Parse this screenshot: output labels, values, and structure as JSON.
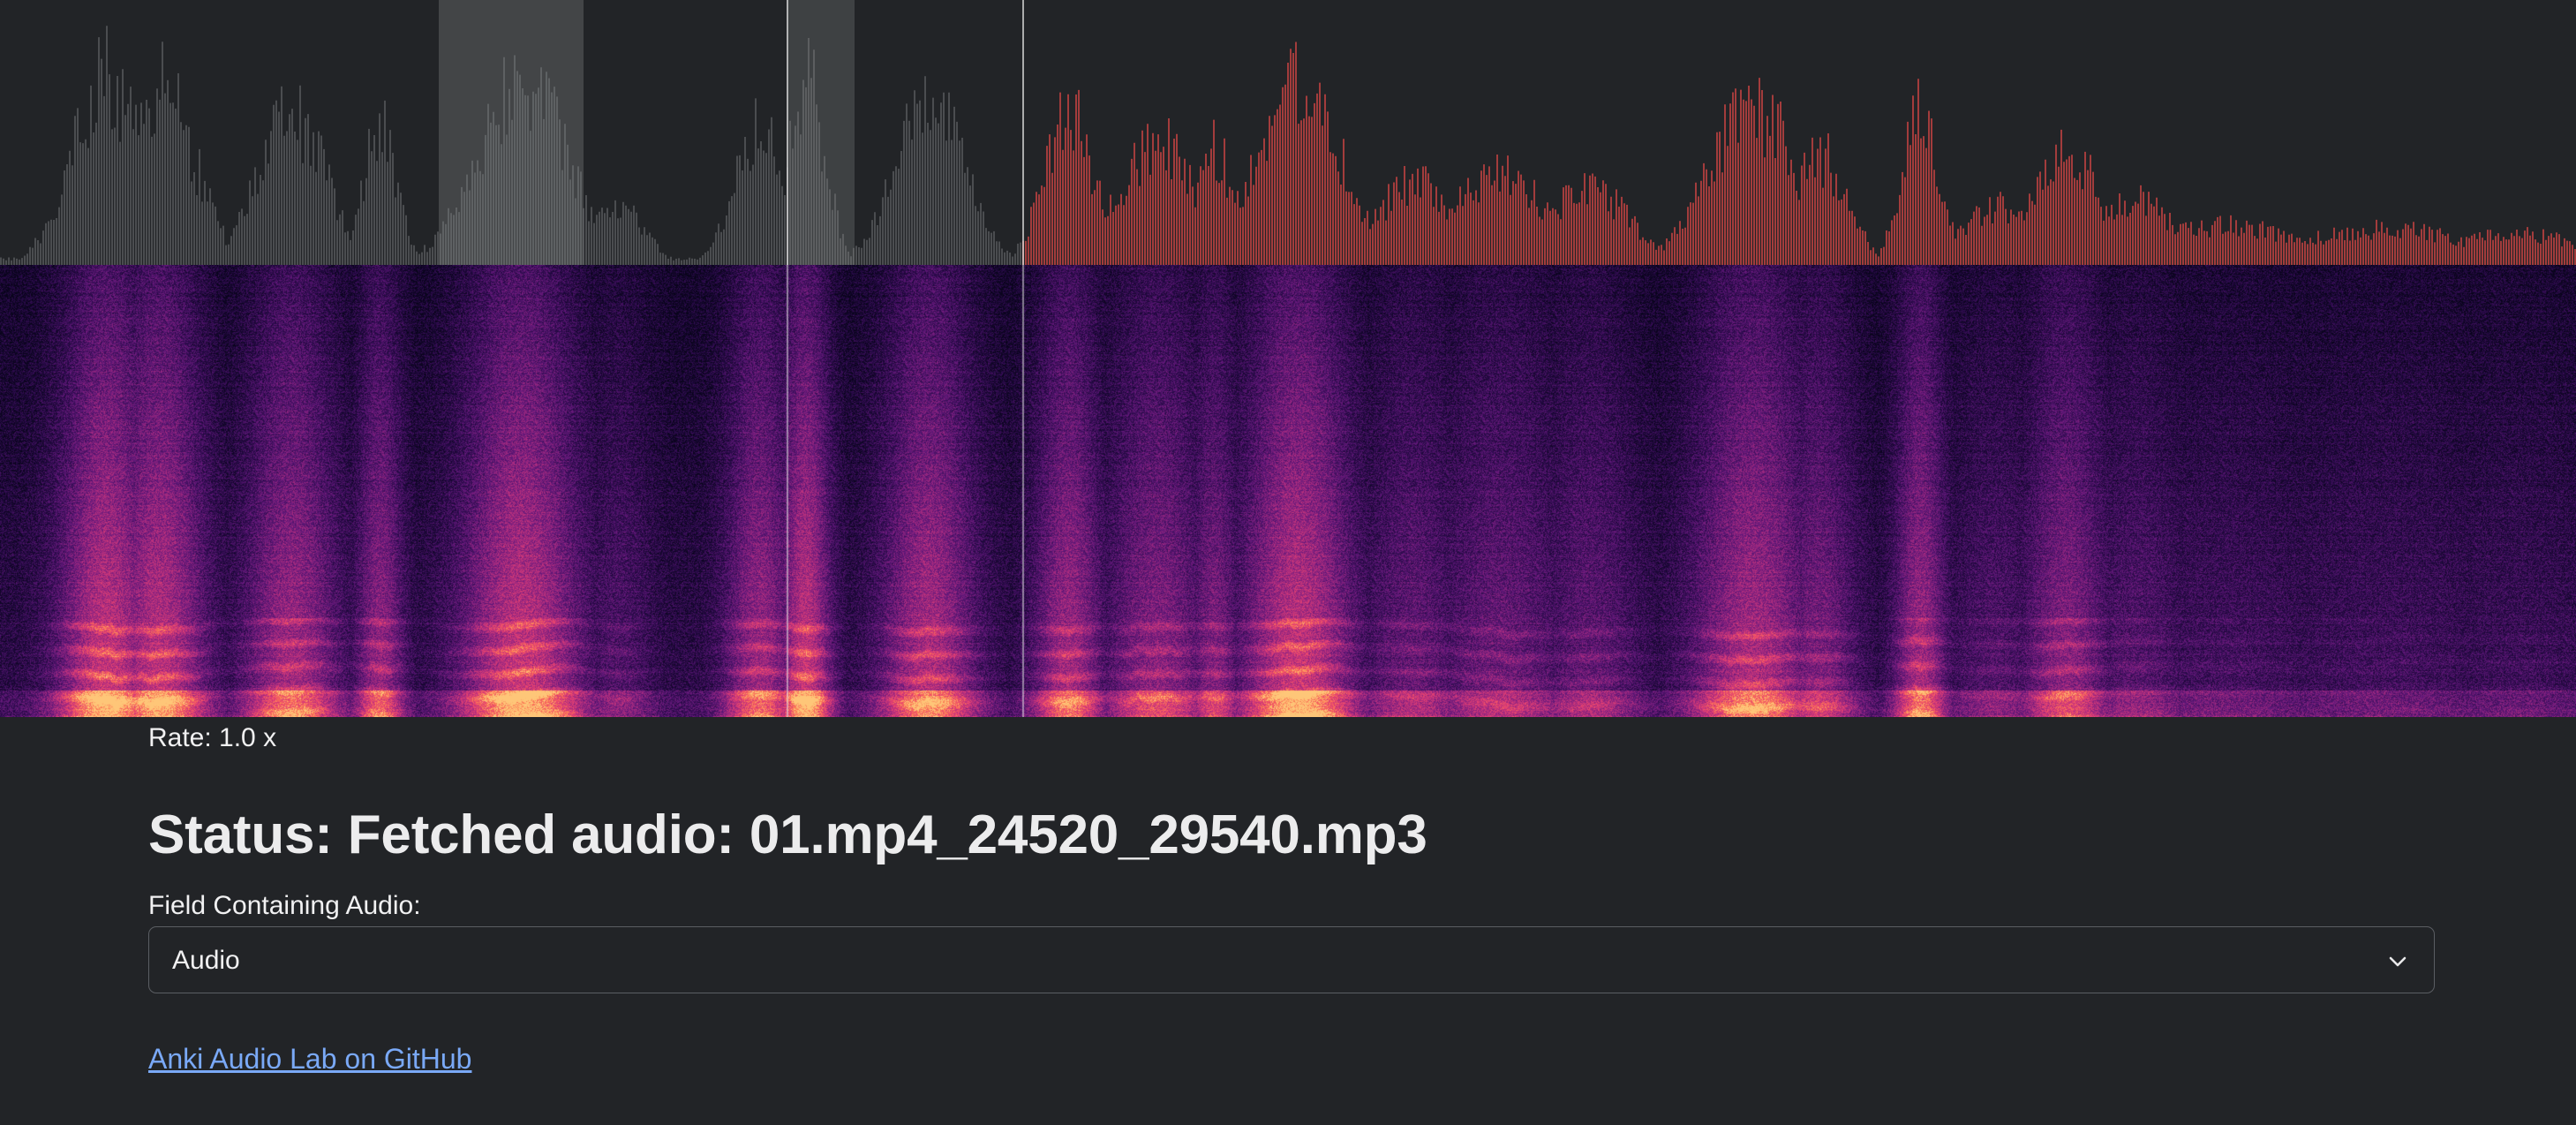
{
  "player": {
    "rate_label": "Rate: 1.0 x"
  },
  "status": {
    "text": "Status: Fetched audio: 01.mp4_24520_29540.mp3"
  },
  "field": {
    "label": "Field Containing Audio:",
    "selected": "Audio"
  },
  "footer": {
    "link_text": "Anki Audio Lab on GitHub"
  },
  "colors": {
    "background": "#222427",
    "waveform_unplayed": "#4b4d50",
    "waveform_played": "#a33c3c",
    "selection_overlay": "#8a8b8d",
    "link": "#7aa9f7"
  },
  "icons": {
    "select_indicator": "chevron-down-icon"
  }
}
